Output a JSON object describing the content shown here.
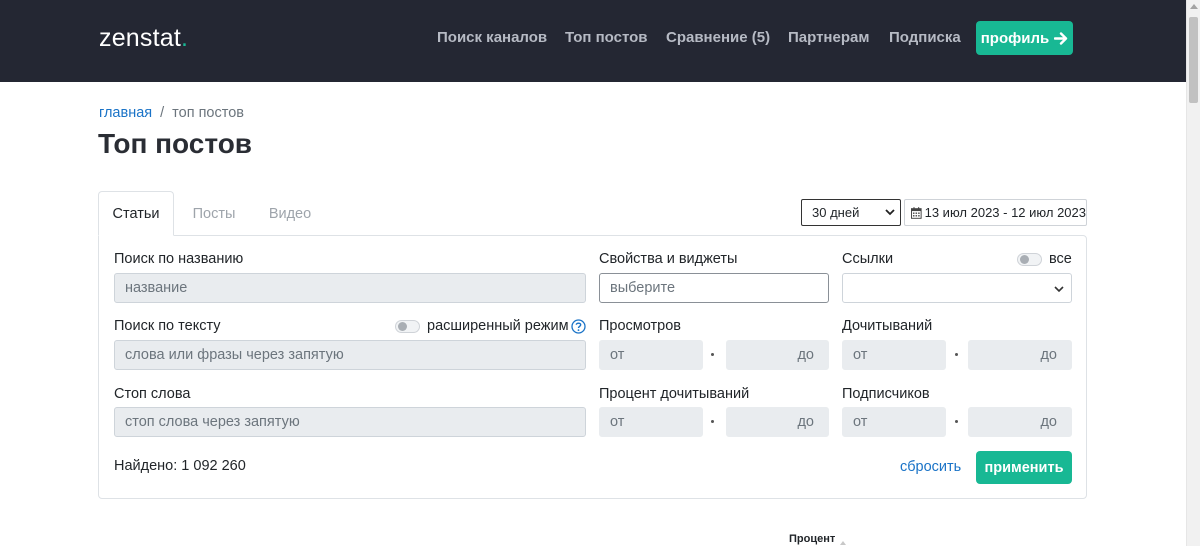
{
  "header": {
    "logo_text": "zenstat",
    "logo_dot": ".",
    "nav": [
      {
        "label": "Поиск каналов"
      },
      {
        "label": "Топ постов"
      },
      {
        "label": "Сравнение (5)"
      },
      {
        "label": "Партнерам"
      },
      {
        "label": "Подписка"
      }
    ],
    "profile_button": "профиль",
    "profile_icon": "arrow-right-icon"
  },
  "breadcrumb": {
    "home": "главная",
    "separator": "/",
    "current": "топ постов"
  },
  "page_title": "Топ постов",
  "tabs": [
    {
      "label": "Статьи",
      "active": true
    },
    {
      "label": "Посты",
      "active": false
    },
    {
      "label": "Видео",
      "active": false
    }
  ],
  "period": {
    "selected": "30 дней",
    "date_range": "13 июл 2023 - 12 июл 2023",
    "calendar_icon": "calendar-icon"
  },
  "filters": {
    "title_search": {
      "label": "Поиск по названию",
      "placeholder": "название"
    },
    "text_search": {
      "label": "Поиск по тексту",
      "placeholder": "слова или фразы через запятую",
      "advanced_label": "расширенный режим"
    },
    "stop_words": {
      "label": "Стоп слова",
      "placeholder": "стоп слова через запятую"
    },
    "properties": {
      "label": "Свойства и виджеты",
      "placeholder": "выберите"
    },
    "links": {
      "label": "Ссылки",
      "toggle_label": "все",
      "value": ""
    },
    "views": {
      "label": "Просмотров",
      "from": "от",
      "to": "до"
    },
    "read_through": {
      "label": "Дочитываний",
      "from": "от",
      "to": "до"
    },
    "read_percent": {
      "label": "Процент дочитываний",
      "from": "от",
      "to": "до"
    },
    "subscribers": {
      "label": "Подписчиков",
      "from": "от",
      "to": "до"
    }
  },
  "results": {
    "found_label": "Найдено: 1 092 260",
    "reset": "сбросить",
    "apply": "применить"
  },
  "table": {
    "partial_header": "Процент"
  },
  "colors": {
    "navbar": "#242733",
    "accent": "#18b894",
    "link": "#1a73c7"
  }
}
